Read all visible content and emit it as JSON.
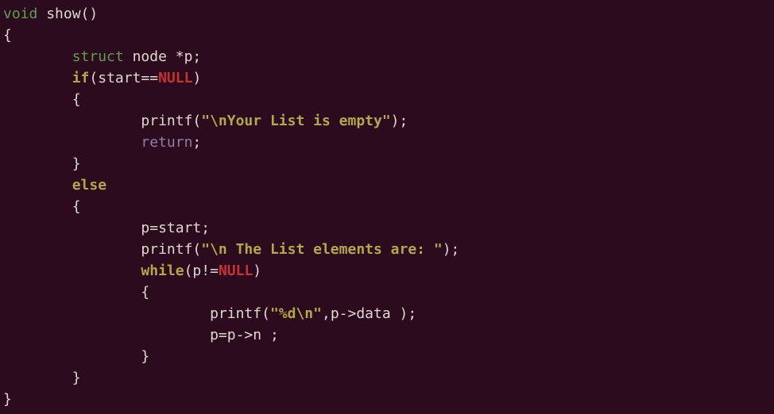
{
  "code": {
    "l1_void": "void",
    "l1_show": " show()",
    "l2_brace": "{",
    "l3_indent": "        ",
    "l3_struct": "struct",
    "l3_rest": " node *p;",
    "l4_indent": "        ",
    "l4_if": "if",
    "l4_open": "(start==",
    "l4_null": "NULL",
    "l4_close": ")",
    "l5": "        {",
    "l6_indent": "                printf(",
    "l6_str": "\"\\nYour List is empty\"",
    "l6_end": ");",
    "l7_indent": "                ",
    "l7_return": "return",
    "l7_semi": ";",
    "l8": "        }",
    "l9_indent": "        ",
    "l9_else": "else",
    "l10": "        {",
    "l11": "                p=start;",
    "l12_indent": "                printf(",
    "l12_str": "\"\\n The List elements are: \"",
    "l12_end": ");",
    "l13_indent": "                ",
    "l13_while": "while",
    "l13_open": "(p!=",
    "l13_null": "NULL",
    "l13_close": ")",
    "l14": "                {",
    "l15_indent": "                        printf(",
    "l15_str": "\"%d\\n\"",
    "l15_end": ",p->data );",
    "l16": "                        p=p->n ;",
    "l17": "                }",
    "l18": "        }",
    "l19": "}"
  }
}
